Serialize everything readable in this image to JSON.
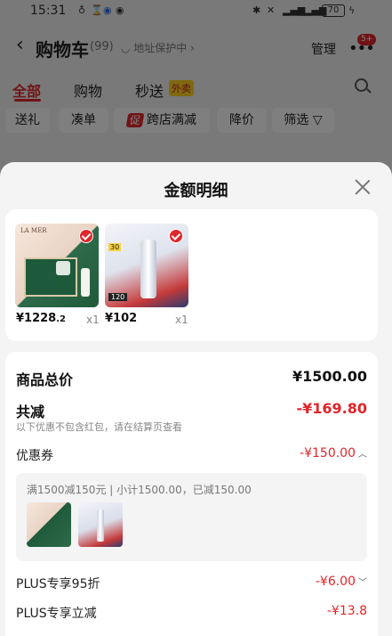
{
  "status_bar": {
    "time": "15:31",
    "battery": "70"
  },
  "header": {
    "title": "购物车",
    "count": "(99)",
    "address_protect": "地址保护中",
    "manage": "管理",
    "badge": "5+"
  },
  "tabs": {
    "all": "全部",
    "shopping": "购物",
    "flash": "秒送",
    "waimai": "外卖"
  },
  "chips": {
    "gift": "送礼",
    "combine": "凑单",
    "promo_tag": "促",
    "cross_store": "跨店满减",
    "price_drop": "降价",
    "filter": "筛选"
  },
  "sheet": {
    "title": "金额明细",
    "products": [
      {
        "price_main": "¥1228",
        "price_dec": ".2",
        "qty": "x1",
        "thumb_text": "LA MER"
      },
      {
        "price_main": "¥102",
        "price_dec": "",
        "qty": "x1",
        "thumb_num": "30",
        "thumb_num2": "120"
      }
    ],
    "summary": {
      "total_label": "商品总价",
      "total_value": "¥1500.00",
      "discount_label": "共减",
      "discount_value": "-¥169.80",
      "discount_note": "以下优惠不包含红包，请在结算页查看",
      "coupon_label": "优惠券",
      "coupon_value": "-¥150.00",
      "coupon_detail": "满1500减150元 | 小计1500.00，已减150.00",
      "plus95_label": "PLUS专享95折",
      "plus95_value": "-¥6.00",
      "plus_label": "PLUS专享立减",
      "plus_value": "-¥13.8"
    }
  },
  "colors": {
    "accent": "#e0262b"
  }
}
